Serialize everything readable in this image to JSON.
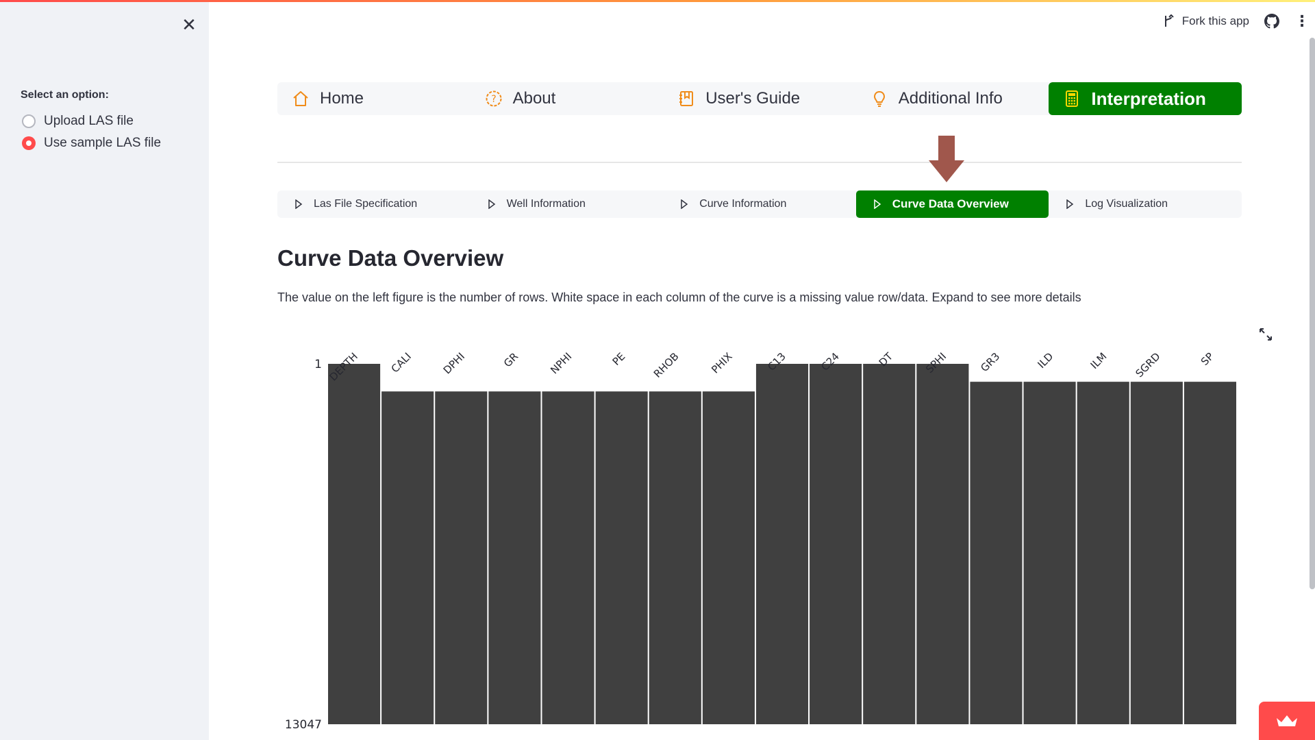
{
  "header": {
    "fork_label": "Fork this app",
    "github_icon": "github-icon",
    "menu_icon": "kebab-menu-icon"
  },
  "sidebar": {
    "option_label": "Select an option:",
    "options": [
      {
        "label": "Upload LAS file",
        "selected": false
      },
      {
        "label": "Use sample LAS file",
        "selected": true
      }
    ]
  },
  "main_nav": [
    {
      "label": "Home",
      "icon": "house-icon",
      "active": false
    },
    {
      "label": "About",
      "icon": "question-circle-icon",
      "active": false
    },
    {
      "label": "User's Guide",
      "icon": "journal-bookmark-icon",
      "active": false
    },
    {
      "label": "Additional Info",
      "icon": "lightbulb-icon",
      "active": false
    },
    {
      "label": "Interpretation",
      "icon": "calculator-icon",
      "active": true
    }
  ],
  "sub_nav": [
    {
      "label": "Las File Specification",
      "active": false
    },
    {
      "label": "Well Information",
      "active": false
    },
    {
      "label": "Curve Information",
      "active": false
    },
    {
      "label": "Curve Data Overview",
      "active": true
    },
    {
      "label": "Log Visualization",
      "active": false
    }
  ],
  "content": {
    "title": "Curve Data Overview",
    "description": "The value on the left figure is the number of rows. White space in each column of the curve is a missing value row/data. Expand to see more details"
  },
  "colors": {
    "accent_green": "#008000",
    "streamlit_red": "#ff4b4b",
    "bar_fill": "#404040",
    "annotation_arrow": "#a0574c"
  },
  "chart_data": {
    "type": "bar",
    "title": "",
    "categories": [
      "DEPTH",
      "CALI",
      "DPHI",
      "GR",
      "NPHI",
      "PE",
      "RHOB",
      "PHIX",
      "C13",
      "C24",
      "DT",
      "SPHI",
      "GR3",
      "ILD",
      "ILM",
      "SGRD",
      "SP"
    ],
    "first_present_row": [
      1,
      1000,
      1000,
      1000,
      1000,
      1000,
      1000,
      1000,
      1,
      1,
      1,
      1,
      650,
      650,
      650,
      650,
      650
    ],
    "y_tick_labels": [
      "1",
      "13047"
    ],
    "ylim": [
      1,
      13047
    ],
    "y_inverted": true
  }
}
